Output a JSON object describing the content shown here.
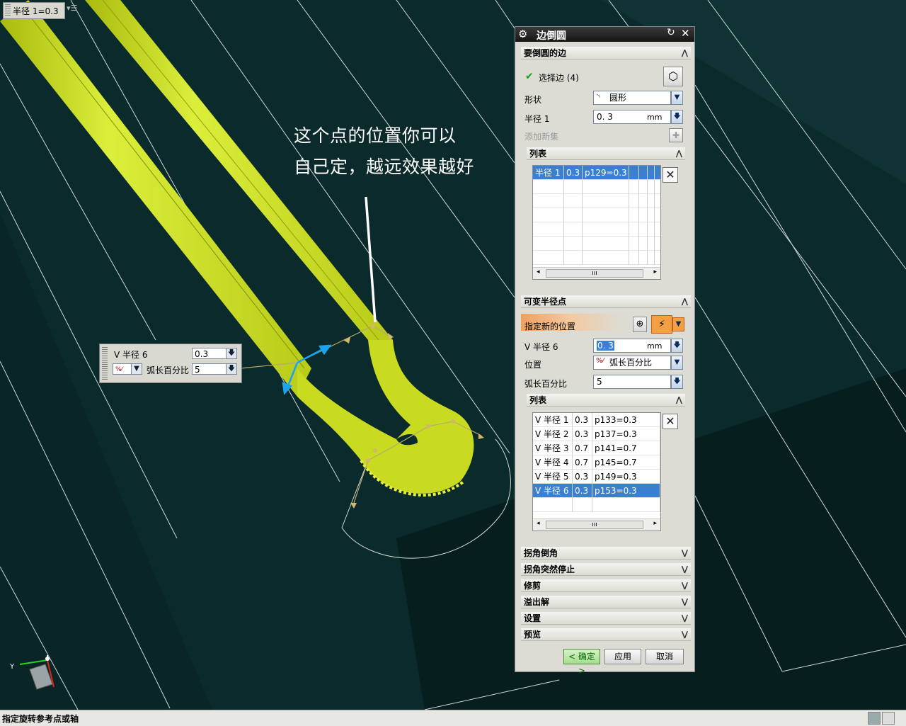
{
  "viewport": {
    "top_tag": "半径 1=0.3",
    "annotation_line1": "这个点的位置你可以",
    "annotation_line2": "自己定，越远效果越好",
    "mini_dialog": {
      "v_radius_label": "V 半径 6",
      "v_radius_value": "0.3",
      "position_label": "弧长百分比",
      "position_value": "5"
    },
    "triad_y": "Y"
  },
  "dialog": {
    "title": "边倒圆",
    "edges_section": {
      "header": "要倒圆的边",
      "select_edge": "选择边 (4)",
      "shape_label": "形状",
      "shape_value": "圆形",
      "radius_label": "半径 1",
      "radius_value": "0. 3",
      "radius_unit": "mm",
      "add_new_set": "添加新集",
      "list_header": "列表",
      "list_rows": [
        [
          "半径 1",
          "0.3",
          "p129=0.3"
        ]
      ]
    },
    "var_section": {
      "header": "可变半径点",
      "specify_location": "指定新的位置",
      "v_radius_label": "V 半径 6",
      "v_radius_value": "0. 3",
      "v_radius_unit": "mm",
      "position_label": "位置",
      "position_value": "弧长百分比",
      "arc_pct_label": "弧长百分比",
      "arc_pct_value": "5",
      "list_header": "列表",
      "list_rows": [
        [
          "V 半径 1",
          "0.3",
          "p133=0.3"
        ],
        [
          "V 半径 2",
          "0.3",
          "p137=0.3"
        ],
        [
          "V 半径 3",
          "0.7",
          "p141=0.7"
        ],
        [
          "V 半径 4",
          "0.7",
          "p145=0.7"
        ],
        [
          "V 半径 5",
          "0.3",
          "p149=0.3"
        ],
        [
          "V 半径 6",
          "0.3",
          "p153=0.3"
        ]
      ],
      "selected_row": 5
    },
    "collapsed_sections": [
      "拐角倒角",
      "拐角突然停止",
      "修剪",
      "溢出解",
      "设置",
      "预览"
    ],
    "buttons": {
      "ok": "< 确定 >",
      "apply": "应用",
      "cancel": "取消"
    }
  },
  "status_bar": {
    "message": "指定旋转参考点或轴"
  },
  "colors": {
    "viewport_bg": "#0b2a2b",
    "part_yellow": "#c9dc1e",
    "selection_blue": "#3a7fd0",
    "highlight_orange": "#f0a060"
  }
}
